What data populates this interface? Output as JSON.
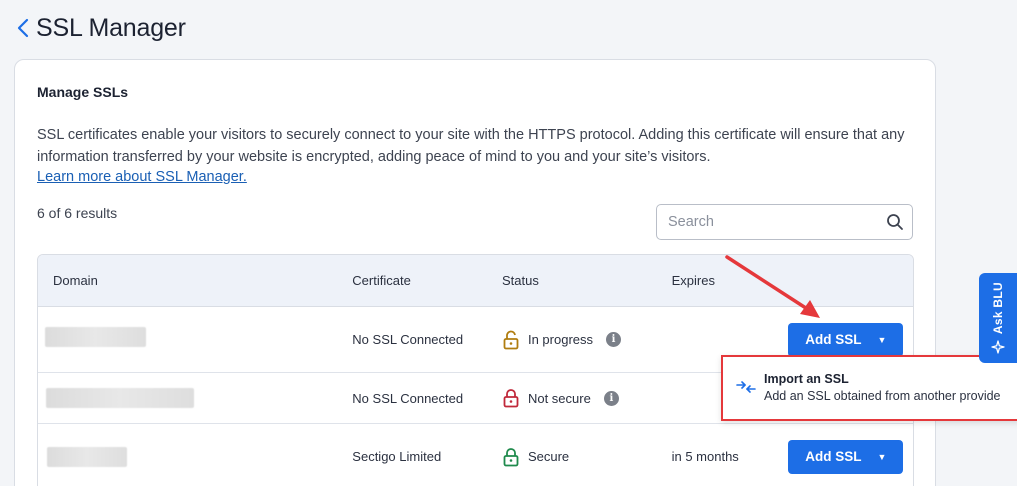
{
  "header": {
    "title": "SSL Manager"
  },
  "card": {
    "title": "Manage SSLs",
    "description": "SSL certificates enable your visitors to securely connect to your site with the HTTPS protocol. Adding this certificate will ensure that any information transferred by your website is encrypted, adding peace of mind to you and your site’s visitors.",
    "learn_link": "Learn more about SSL Manager.",
    "results_count": "6 of 6 results",
    "search": {
      "placeholder": "Search",
      "value": ""
    }
  },
  "table": {
    "columns": [
      "Domain",
      "Certificate",
      "Status",
      "Expires"
    ],
    "rows": [
      {
        "certificate": "No SSL Connected",
        "status": "In progress",
        "status_color": "#b07d10",
        "expires": "",
        "action": "Add SSL",
        "has_info": true
      },
      {
        "certificate": "No SSL Connected",
        "status": "Not secure",
        "status_color": "#c0283a",
        "expires": "",
        "action": "",
        "has_info": true
      },
      {
        "certificate": "Sectigo Limited",
        "status": "Secure",
        "status_color": "#1f8a4c",
        "expires": "in 5 months",
        "action": "Add SSL",
        "has_info": false
      }
    ]
  },
  "dropdown": {
    "item_title": "Import an SSL",
    "item_subtitle": "Add an SSL obtained from another provide"
  },
  "ask_blu": {
    "label": "Ask BLU"
  },
  "colors": {
    "primary": "#1d6ee6",
    "highlight": "#e5383b"
  }
}
